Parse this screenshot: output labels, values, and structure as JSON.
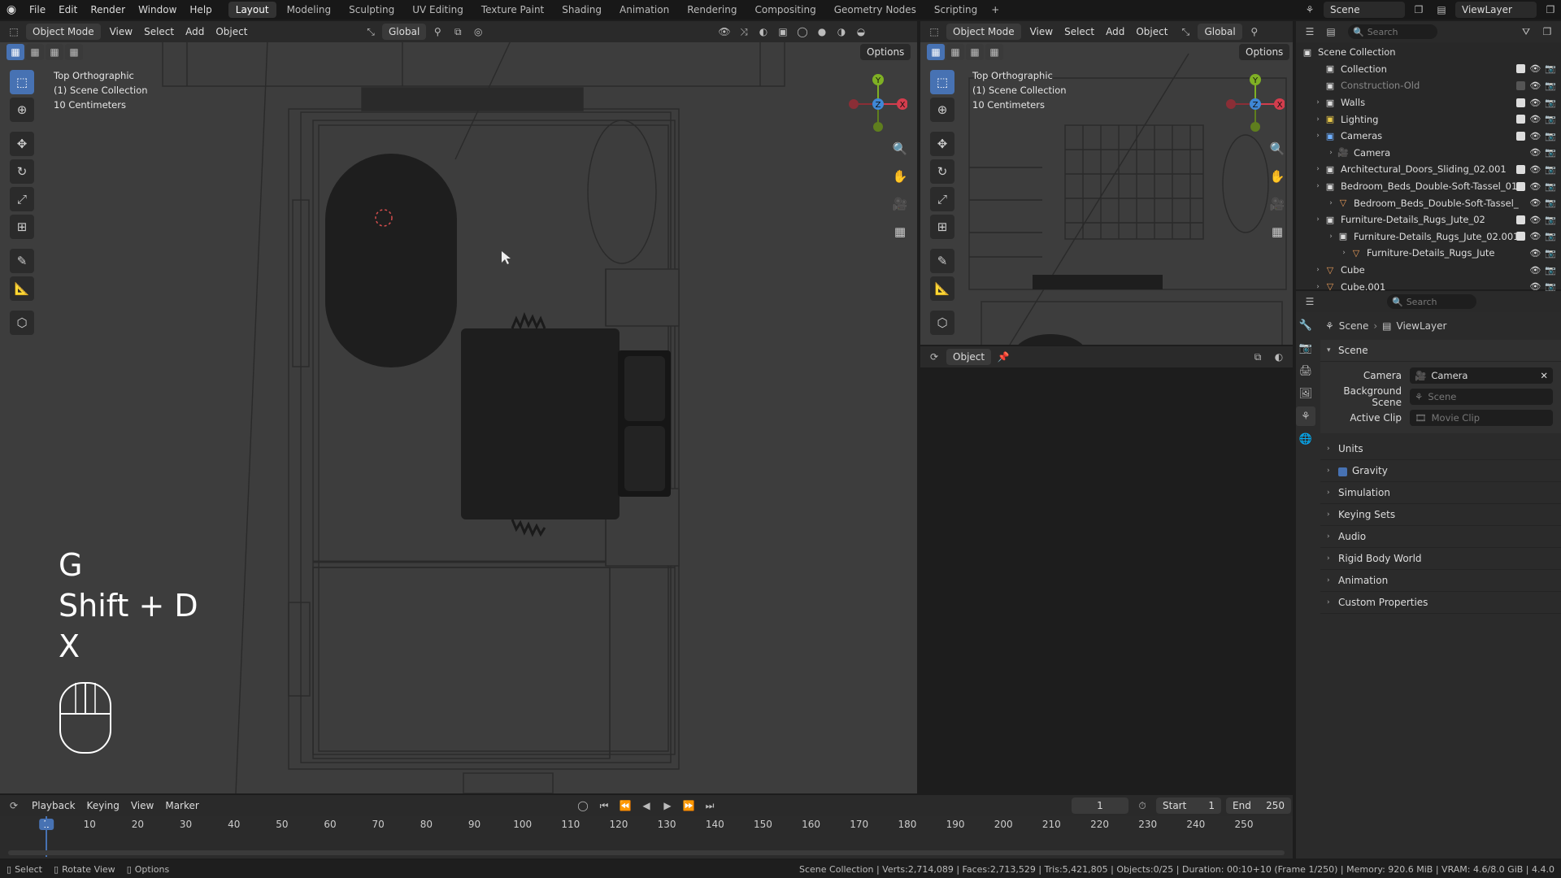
{
  "topbar": {
    "menus": [
      "File",
      "Edit",
      "Render",
      "Window",
      "Help"
    ],
    "workspaces": [
      "Layout",
      "Modeling",
      "Sculpting",
      "UV Editing",
      "Texture Paint",
      "Shading",
      "Animation",
      "Rendering",
      "Compositing",
      "Geometry Nodes",
      "Scripting"
    ],
    "active_workspace": "Layout",
    "scene": "Scene",
    "view_layer": "ViewLayer"
  },
  "viewport_left": {
    "mode": "Object Mode",
    "menus": [
      "View",
      "Select",
      "Add",
      "Object"
    ],
    "orientation": "Global",
    "options_label": "Options",
    "info": [
      "Top Orthographic",
      "(1) Scene Collection",
      "10 Centimeters"
    ],
    "key_overlay": [
      "G",
      "Shift + D",
      "X"
    ]
  },
  "viewport_right": {
    "mode": "Object Mode",
    "menus": [
      "View",
      "Select",
      "Add",
      "Object"
    ],
    "orientation": "Global",
    "options_label": "Options",
    "info": [
      "Top Orthographic",
      "(1) Scene Collection",
      "10 Centimeters"
    ]
  },
  "node_editor": {
    "mode": "Object"
  },
  "outliner": {
    "search_placeholder": "Search",
    "root": "Scene Collection",
    "rows": [
      {
        "label": "Collection",
        "indent": 1,
        "icon": "collection",
        "checked": true
      },
      {
        "label": "Construction-Old",
        "indent": 1,
        "icon": "collection",
        "checked": false,
        "dim": true
      },
      {
        "label": "Walls",
        "indent": 1,
        "icon": "collection",
        "checked": true
      },
      {
        "label": "Lighting",
        "indent": 1,
        "icon": "collection-yellow",
        "checked": true
      },
      {
        "label": "Cameras",
        "indent": 1,
        "icon": "collection-blue",
        "checked": true
      },
      {
        "label": "Camera",
        "indent": 2,
        "icon": "camera",
        "checked": null
      },
      {
        "label": "Architectural_Doors_Sliding_02.001",
        "indent": 1,
        "icon": "collection",
        "checked": true
      },
      {
        "label": "Bedroom_Beds_Double-Soft-Tassel_01.",
        "indent": 1,
        "icon": "collection",
        "checked": true
      },
      {
        "label": "Bedroom_Beds_Double-Soft-Tassel_",
        "indent": 2,
        "icon": "mesh",
        "checked": null
      },
      {
        "label": "Furniture-Details_Rugs_Jute_02",
        "indent": 1,
        "icon": "collection",
        "checked": true
      },
      {
        "label": "Furniture-Details_Rugs_Jute_02.001",
        "indent": 2,
        "icon": "collection",
        "checked": true
      },
      {
        "label": "Furniture-Details_Rugs_Jute",
        "indent": 3,
        "icon": "mesh",
        "checked": null
      },
      {
        "label": "Cube",
        "indent": 1,
        "icon": "mesh",
        "checked": null
      },
      {
        "label": "Cube.001",
        "indent": 1,
        "icon": "mesh",
        "checked": null
      }
    ]
  },
  "properties": {
    "search_placeholder": "Search",
    "breadcrumb": [
      "Scene",
      "ViewLayer"
    ],
    "panel_title": "Scene",
    "fields": [
      {
        "label": "Camera",
        "value": "Camera",
        "placeholder": false
      },
      {
        "label": "Background Scene",
        "value": "Scene",
        "placeholder": true
      },
      {
        "label": "Active Clip",
        "value": "Movie Clip",
        "placeholder": true
      }
    ],
    "subpanels": [
      "Units",
      "Gravity",
      "Simulation",
      "Keying Sets",
      "Audio",
      "Rigid Body World",
      "Animation",
      "Custom Properties"
    ]
  },
  "timeline": {
    "menus": [
      "Playback",
      "Keying",
      "View",
      "Marker"
    ],
    "current_frame": "1",
    "start_label": "Start",
    "start": "1",
    "end_label": "End",
    "end": "250",
    "ticks": [
      "1",
      "10",
      "20",
      "30",
      "40",
      "50",
      "60",
      "70",
      "80",
      "90",
      "100",
      "110",
      "120",
      "130",
      "140",
      "150",
      "160",
      "170",
      "180",
      "190",
      "200",
      "210",
      "220",
      "230",
      "240",
      "250"
    ]
  },
  "statusbar": {
    "left": [
      "Select",
      "Rotate View",
      "Options"
    ],
    "right": "Scene Collection | Verts:2,714,089 | Faces:2,713,529 | Tris:5,421,805 | Objects:0/25 | Duration: 00:10+10 (Frame 1/250) | Memory: 920.6 MiB | VRAM: 4.6/8.0 GiB | 4.4.0"
  }
}
